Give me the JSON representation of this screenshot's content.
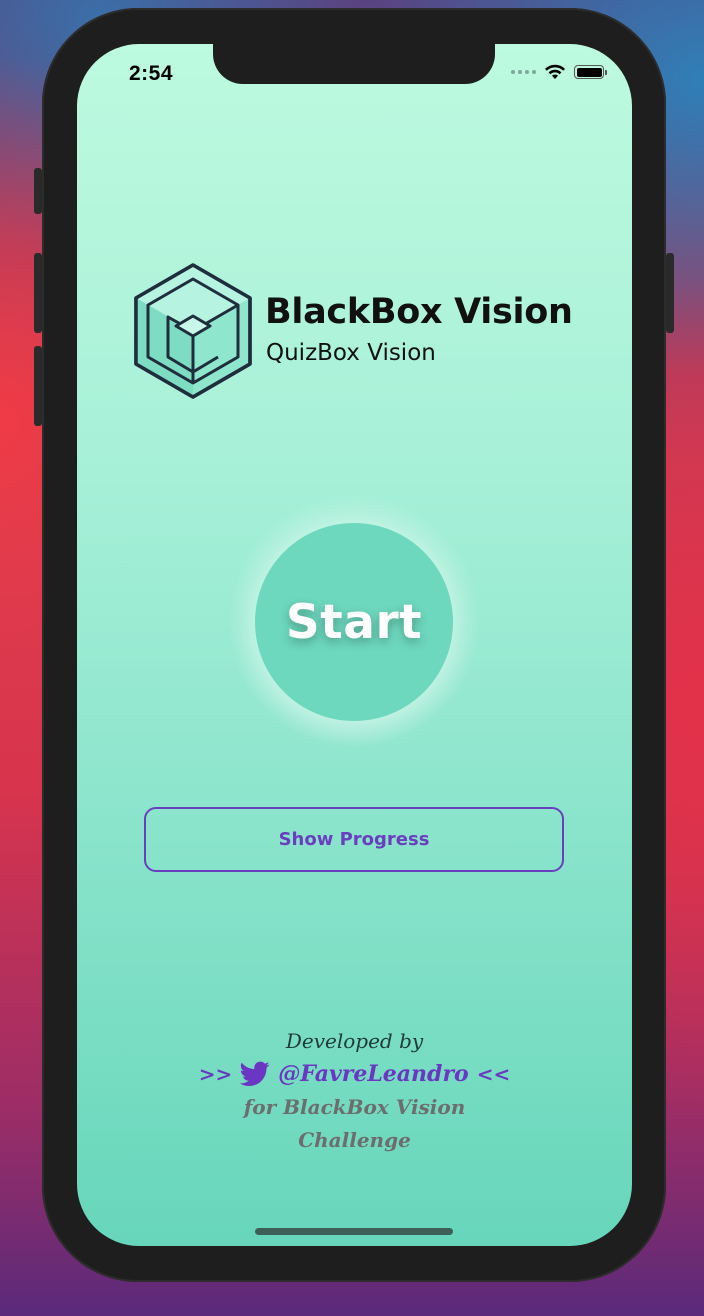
{
  "status_bar": {
    "time": "2:54"
  },
  "brand": {
    "title": "BlackBox Vision",
    "subtitle": "QuizBox Vision",
    "logo_icon": "cube-logo-icon"
  },
  "actions": {
    "start_label": "Start",
    "progress_label": "Show Progress"
  },
  "credits": {
    "developed_by": "Developed by",
    "arrow_left": ">>",
    "handle": "@FavreLeandro",
    "arrow_right": "<<",
    "for_line": "for BlackBox Vision",
    "challenge_line": "Challenge",
    "icon": "twitter-icon"
  },
  "colors": {
    "accent": "#6a3fbf",
    "start_button": "#6dd8be",
    "background_top": "#bdfadf",
    "background_bottom": "#67d6bb"
  }
}
